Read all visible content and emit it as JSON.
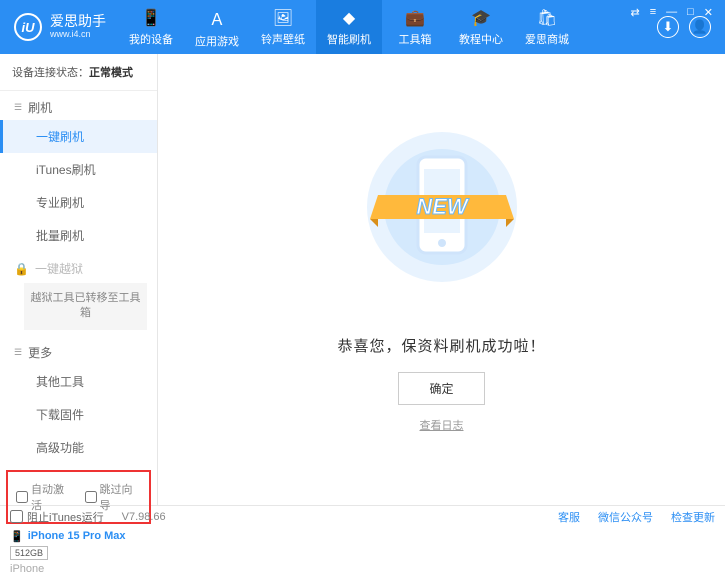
{
  "header": {
    "logo_letters": "iU",
    "app_name": "爱思助手",
    "url": "www.i4.cn",
    "nav": [
      {
        "label": "我的设备"
      },
      {
        "label": "应用游戏"
      },
      {
        "label": "铃声壁纸"
      },
      {
        "label": "智能刷机"
      },
      {
        "label": "工具箱"
      },
      {
        "label": "教程中心"
      },
      {
        "label": "爱思商城"
      }
    ]
  },
  "sidebar": {
    "status_label": "设备连接状态：",
    "status_value": "正常模式",
    "flash_section": "刷机",
    "items_flash": [
      "一键刷机",
      "iTunes刷机",
      "专业刷机",
      "批量刷机"
    ],
    "jailbreak_section": "一键越狱",
    "jailbreak_note": "越狱工具已转移至工具箱",
    "more_section": "更多",
    "items_more": [
      "其他工具",
      "下载固件",
      "高级功能"
    ],
    "auto_activate": "自动激活",
    "skip_guide": "跳过向导",
    "device_name": "iPhone 15 Pro Max",
    "device_storage": "512GB",
    "device_type": "iPhone"
  },
  "main": {
    "new_badge": "NEW",
    "message": "恭喜您，保资料刷机成功啦！",
    "ok": "确定",
    "view_log": "查看日志"
  },
  "footer": {
    "block_itunes": "阻止iTunes运行",
    "version": "V7.98.66",
    "customer": "客服",
    "wechat": "微信公众号",
    "check_update": "检查更新"
  }
}
